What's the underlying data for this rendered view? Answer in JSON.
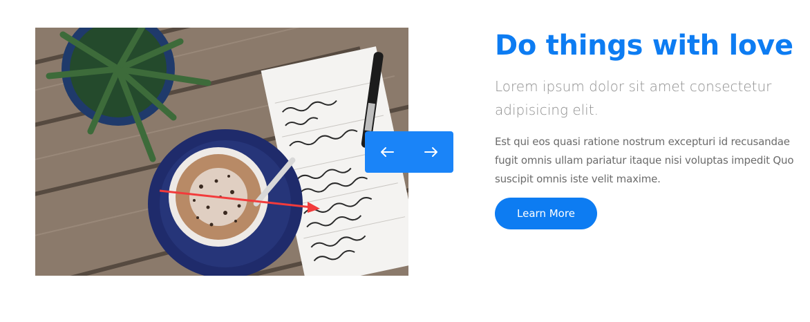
{
  "hero": {
    "image_icon": "coffee-notebook-photo",
    "nav": {
      "prev_icon": "arrow-left-icon",
      "next_icon": "arrow-right-icon"
    },
    "title": "Do things with love",
    "lead": "Lorem ipsum dolor sit amet consectetur adipisicing elit.",
    "body": "Est qui eos quasi ratione nostrum excepturi id recusandae fugit omnis ullam pariatur itaque nisi voluptas impedit Quo suscipit omnis iste velit maxime.",
    "cta_label": "Learn More"
  },
  "colors": {
    "accent": "#0d7cf2",
    "nav_bg": "#1a84f8",
    "lead": "#8f8f8f",
    "body": "#6b6b6b"
  }
}
